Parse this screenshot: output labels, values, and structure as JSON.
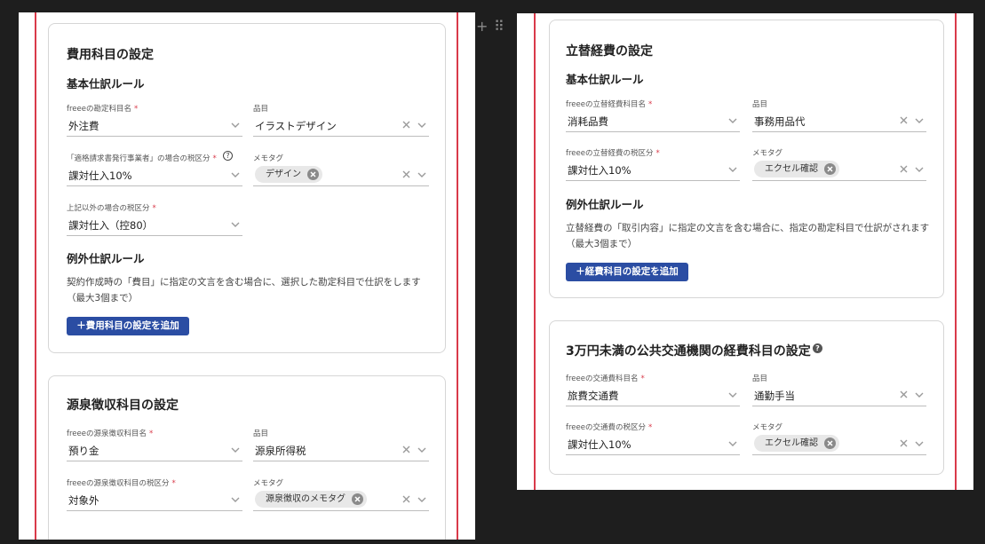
{
  "left": {
    "expense": {
      "title": "費用科目の設定",
      "basic_rule": "基本仕訳ルール",
      "account_label": "freeeの勘定科目名",
      "account_value": "外注費",
      "item_label": "品目",
      "item_value": "イラストデザイン",
      "tax_label": "「適格請求書発行事業者」の場合の税区分",
      "tax_value": "課対仕入10%",
      "memo_label": "メモタグ",
      "memo_chip": "デザイン",
      "other_tax_label": "上記以外の場合の税区分",
      "other_tax_value": "課対仕入（控80）",
      "exception_rule": "例外仕訳ルール",
      "exception_desc": "契約作成時の「費目」に指定の文言を含む場合に、選択した勘定科目で仕訳をします（最大3個まで）",
      "add_button": "＋費用科目の設定を追加"
    },
    "withholding": {
      "title": "源泉徴収科目の設定",
      "account_label": "freeeの源泉徴収科目名",
      "account_value": "預り金",
      "item_label": "品目",
      "item_value": "源泉所得税",
      "tax_label": "freeeの源泉徴収科目の税区分",
      "tax_value": "対象外",
      "memo_label": "メモタグ",
      "memo_chip": "源泉徴収のメモタグ"
    }
  },
  "toolbar": {
    "add_symbol": "+",
    "drag_symbol": "⠿"
  },
  "right": {
    "reimburse": {
      "title": "立替経費の設定",
      "basic_rule": "基本仕訳ルール",
      "account_label": "freeeの立替経費科目名",
      "account_value": "消耗品費",
      "item_label": "品目",
      "item_value": "事務用品代",
      "tax_label": "freeeの立替経費の税区分",
      "tax_value": "課対仕入10%",
      "memo_label": "メモタグ",
      "memo_chip": "エクセル確認",
      "exception_rule": "例外仕訳ルール",
      "exception_desc": "立替経費の「取引内容」に指定の文言を含む場合に、指定の勘定科目で仕訳がされます（最大3個まで）",
      "add_button": "＋経費科目の設定を追加"
    },
    "transport": {
      "title": "3万円未満の公共交通機関の経費科目の設定",
      "account_label": "freeeの交通費科目名",
      "account_value": "旅費交通費",
      "item_label": "品目",
      "item_value": "通勤手当",
      "tax_label": "freeeの交通費の税区分",
      "tax_value": "課対仕入10%",
      "memo_label": "メモタグ",
      "memo_chip": "エクセル確認"
    }
  },
  "icons": {
    "chevron": "chevron-down-icon",
    "clear": "close-icon",
    "help": "help-icon",
    "chip_remove": "chip-remove-icon"
  },
  "colors": {
    "accent": "#2b4da3",
    "required": "#d93a4a",
    "border_red": "#d93a4a"
  }
}
